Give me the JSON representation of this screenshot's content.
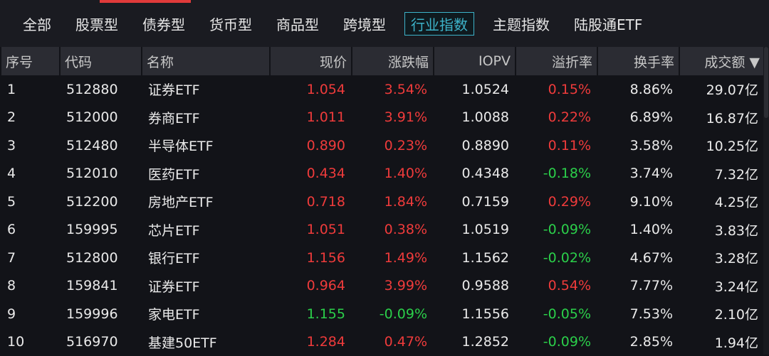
{
  "tabs": [
    {
      "label": "全部",
      "active": false
    },
    {
      "label": "股票型",
      "active": false
    },
    {
      "label": "债券型",
      "active": false
    },
    {
      "label": "货币型",
      "active": false
    },
    {
      "label": "商品型",
      "active": false
    },
    {
      "label": "跨境型",
      "active": false
    },
    {
      "label": "行业指数",
      "active": true
    },
    {
      "label": "主题指数",
      "active": false
    },
    {
      "label": "陆股通ETF",
      "active": false
    }
  ],
  "columns": {
    "index": "序号",
    "code": "代码",
    "name": "名称",
    "price": "现价",
    "change": "涨跌幅",
    "iopv": "IOPV",
    "premium": "溢折率",
    "turnover": "换手率",
    "volume": "成交额 ▼"
  },
  "rows": [
    {
      "index": "1",
      "code": "512880",
      "name": "证券ETF",
      "price": "1.054",
      "change": "3.54%",
      "iopv": "1.0524",
      "premium": "0.15%",
      "turnover": "8.86%",
      "volume": "29.07亿"
    },
    {
      "index": "2",
      "code": "512000",
      "name": "券商ETF",
      "price": "1.011",
      "change": "3.91%",
      "iopv": "1.0088",
      "premium": "0.22%",
      "turnover": "6.89%",
      "volume": "16.87亿"
    },
    {
      "index": "3",
      "code": "512480",
      "name": "半导体ETF",
      "price": "0.890",
      "change": "0.23%",
      "iopv": "0.8890",
      "premium": "0.11%",
      "turnover": "3.58%",
      "volume": "10.25亿"
    },
    {
      "index": "4",
      "code": "512010",
      "name": "医药ETF",
      "price": "0.434",
      "change": "1.40%",
      "iopv": "0.4348",
      "premium": "-0.18%",
      "turnover": "3.74%",
      "volume": "7.32亿"
    },
    {
      "index": "5",
      "code": "512200",
      "name": "房地产ETF",
      "price": "0.718",
      "change": "1.84%",
      "iopv": "0.7159",
      "premium": "0.29%",
      "turnover": "9.10%",
      "volume": "4.25亿"
    },
    {
      "index": "6",
      "code": "159995",
      "name": "芯片ETF",
      "price": "1.051",
      "change": "0.38%",
      "iopv": "1.0519",
      "premium": "-0.09%",
      "turnover": "1.40%",
      "volume": "3.83亿"
    },
    {
      "index": "7",
      "code": "512800",
      "name": "银行ETF",
      "price": "1.156",
      "change": "1.49%",
      "iopv": "1.1562",
      "premium": "-0.02%",
      "turnover": "4.67%",
      "volume": "3.28亿"
    },
    {
      "index": "8",
      "code": "159841",
      "name": "证券ETF",
      "price": "0.964",
      "change": "3.99%",
      "iopv": "0.9588",
      "premium": "0.54%",
      "turnover": "7.77%",
      "volume": "3.24亿"
    },
    {
      "index": "9",
      "code": "159996",
      "name": "家电ETF",
      "price": "1.155",
      "change": "-0.09%",
      "iopv": "1.1556",
      "premium": "-0.05%",
      "turnover": "7.53%",
      "volume": "2.10亿"
    },
    {
      "index": "10",
      "code": "516970",
      "name": "基建50ETF",
      "price": "1.284",
      "change": "0.47%",
      "iopv": "1.2852",
      "premium": "-0.09%",
      "turnover": "2.85%",
      "volume": "1.94亿"
    }
  ],
  "colors": {
    "up": "#ef3b3b",
    "down": "#2bcf4a",
    "accent": "#3db3c9",
    "active_indicator": "#e03a3a"
  }
}
